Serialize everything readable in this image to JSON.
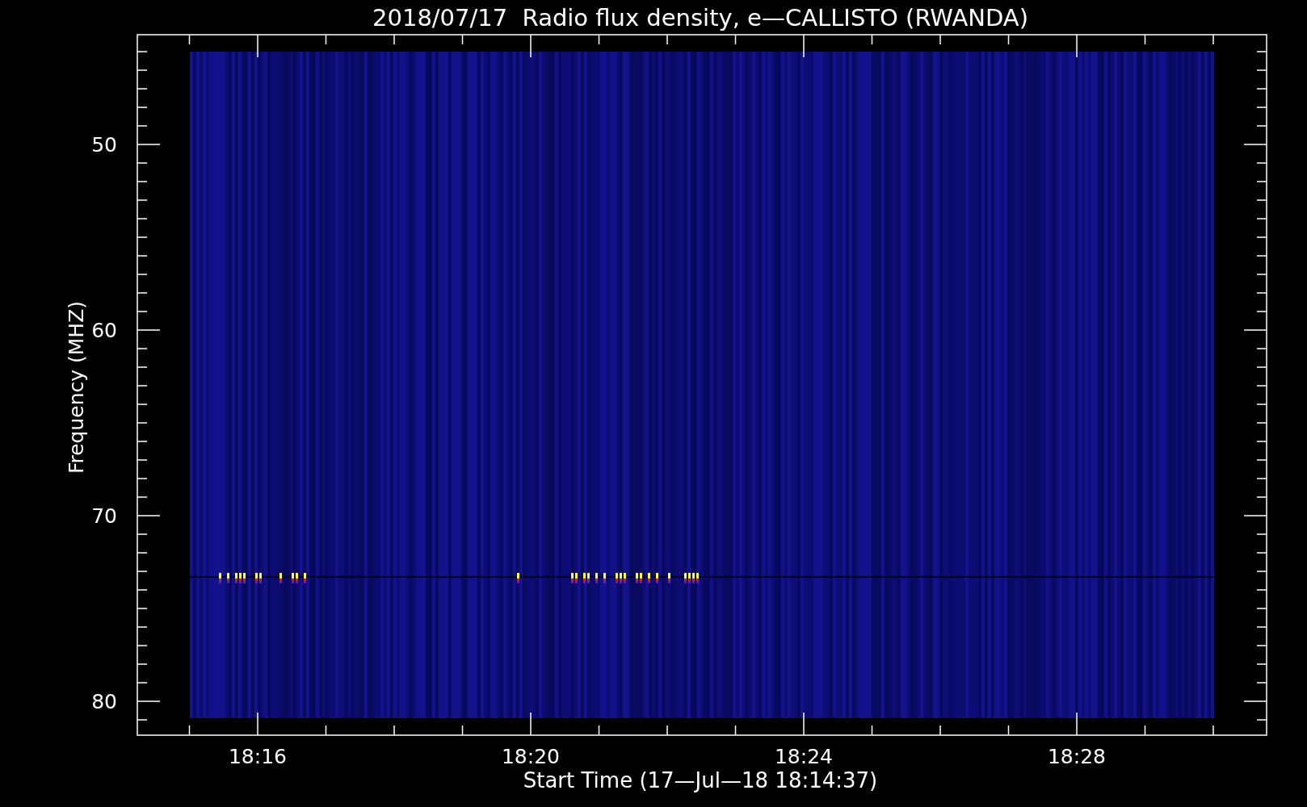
{
  "plot": {
    "title": "2018/07/17  Radio flux density, e—CALLISTO (RWANDA)",
    "y_axis": {
      "label": "Frequency (MHZ)",
      "ticks": [
        "50",
        "60",
        "70",
        "80"
      ]
    },
    "x_axis": {
      "label": "Start Time (17—Jul—18 18:14:37)",
      "ticks": [
        "18:16",
        "18:20",
        "18:24",
        "18:28"
      ]
    }
  }
}
